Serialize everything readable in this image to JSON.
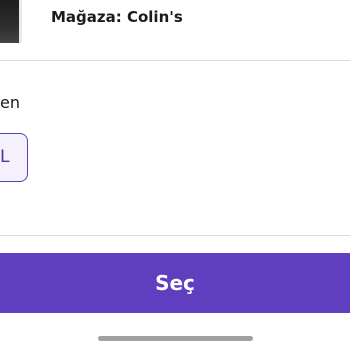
{
  "store": {
    "label": "Mağaza: Colin's"
  },
  "size_section": {
    "title": "en",
    "options": [
      {
        "label": "L",
        "selected": true
      }
    ]
  },
  "actions": {
    "select_label": "Seç"
  },
  "colors": {
    "accent": "#5f3fbf",
    "selected_border": "#5a3fb8",
    "selected_background": "#f4f1fc",
    "divider": "#d9d9d9"
  },
  "icons": {
    "product": "product-thumbnail-image"
  }
}
